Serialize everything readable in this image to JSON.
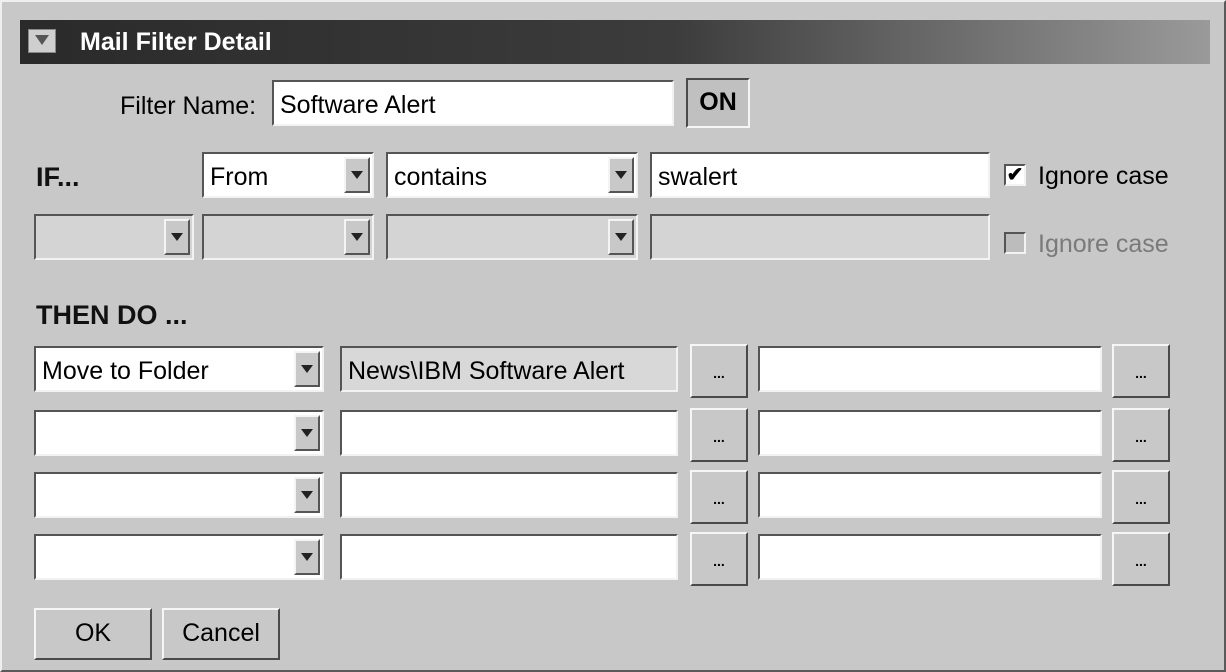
{
  "window": {
    "title": "Mail Filter Detail"
  },
  "filter": {
    "name_label": "Filter Name:",
    "name_value": "Software Alert",
    "on_label": "ON"
  },
  "conditions": {
    "if_label": "IF...",
    "rows": [
      {
        "field": "From",
        "operator": "contains",
        "value": "swalert",
        "ignore_case_label": "Ignore case",
        "ignore_case_checked": "✔"
      },
      {
        "connector": "",
        "field": "",
        "operator": "",
        "value": "",
        "ignore_case_label": "Ignore case",
        "ignore_case_checked": ""
      }
    ]
  },
  "actions": {
    "then_label": "THEN DO ...",
    "browse_label": "...",
    "rows": [
      {
        "action": "Move to Folder",
        "param1": "News\\IBM Software Alert",
        "param2": ""
      },
      {
        "action": "",
        "param1": "",
        "param2": ""
      },
      {
        "action": "",
        "param1": "",
        "param2": ""
      },
      {
        "action": "",
        "param1": "",
        "param2": ""
      }
    ]
  },
  "buttons": {
    "ok": "OK",
    "cancel": "Cancel"
  }
}
